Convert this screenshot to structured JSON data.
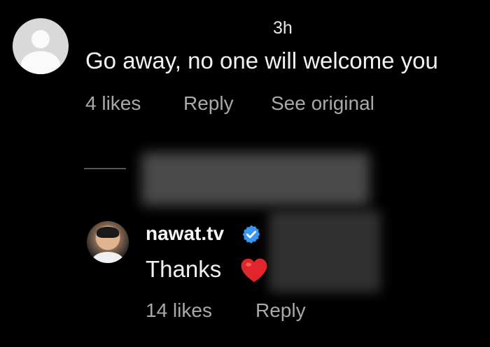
{
  "comment": {
    "time": "3h",
    "text": "Go away, no one will welcome you",
    "likes": "4 likes",
    "reply_label": "Reply",
    "see_original_label": "See original",
    "avatar_icon": "default-profile-icon"
  },
  "reply": {
    "username": "nawat.tv",
    "verified_icon": "verified-badge-icon",
    "text": "Thanks",
    "emoji": "red-heart-icon",
    "likes": "14 likes",
    "reply_label": "Reply"
  },
  "colors": {
    "background": "#000000",
    "primary_text": "#f2f2f2",
    "secondary_text": "#a9a9a9",
    "verified_blue": "#3897f0",
    "heart_red": "#e0262b"
  }
}
